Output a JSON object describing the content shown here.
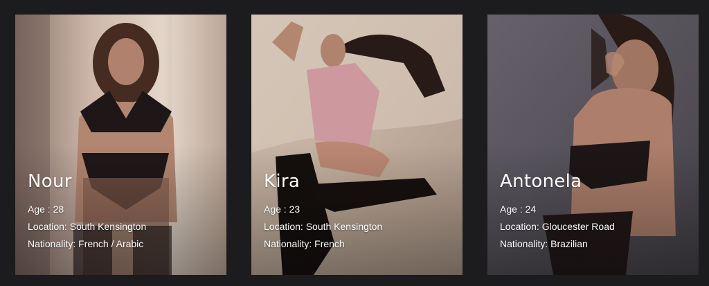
{
  "profiles": [
    {
      "name": "Nour",
      "age_label": "Age : 28",
      "location_label": "Location: South Kensington",
      "nationality_label": "Nationality: French / Arabic"
    },
    {
      "name": "Kira",
      "age_label": "Age : 23",
      "location_label": "Location: South Kensington",
      "nationality_label": "Nationality: French"
    },
    {
      "name": "Antonela",
      "age_label": "Age : 24",
      "location_label": "Location: Gloucester Road",
      "nationality_label": "Nationality: Brazilian"
    }
  ],
  "colors": {
    "page_background": "#1c1b1d",
    "text": "#ffffff",
    "card_1_tone": "#c9a99a",
    "card_2_tone": "#d8c8b6",
    "card_3_tone": "#5f5a62"
  }
}
